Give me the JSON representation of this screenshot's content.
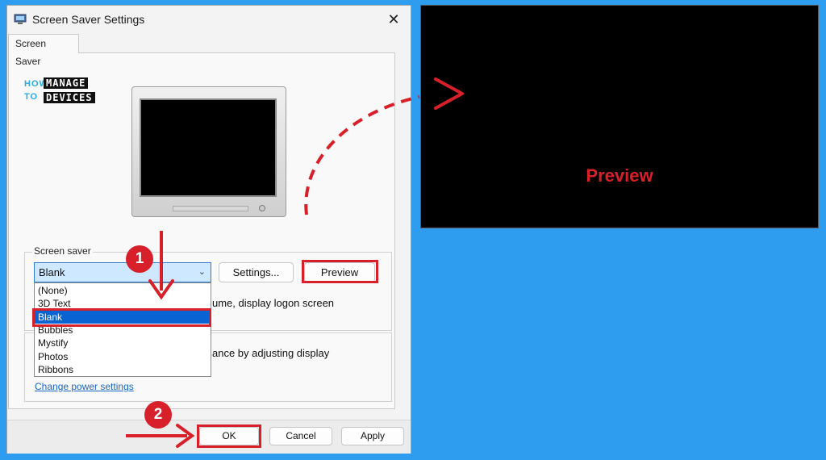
{
  "dialog": {
    "title": "Screen Saver Settings",
    "close_label": "✕",
    "tab_label": "Screen Saver"
  },
  "logo": {
    "how": "HOW",
    "to": "TO",
    "manage": "MANAGE",
    "devices": "DEVICES"
  },
  "screen_saver": {
    "group_label": "Screen saver",
    "selected_value": "Blank",
    "options": [
      "(None)",
      "3D Text",
      "Blank",
      "Bubbles",
      "Mystify",
      "Photos",
      "Ribbons"
    ],
    "settings_button": "Settings...",
    "preview_button": "Preview",
    "resume_text_partial": "ume, display logon screen"
  },
  "power": {
    "text_partial": "ance by adjusting display",
    "link_text": "Change power settings"
  },
  "footer": {
    "ok": "OK",
    "cancel": "Cancel",
    "apply": "Apply"
  },
  "preview_pane": {
    "label": "Preview"
  },
  "annotations": {
    "step1": "1",
    "step2": "2",
    "highlight_color": "#d7202a"
  }
}
